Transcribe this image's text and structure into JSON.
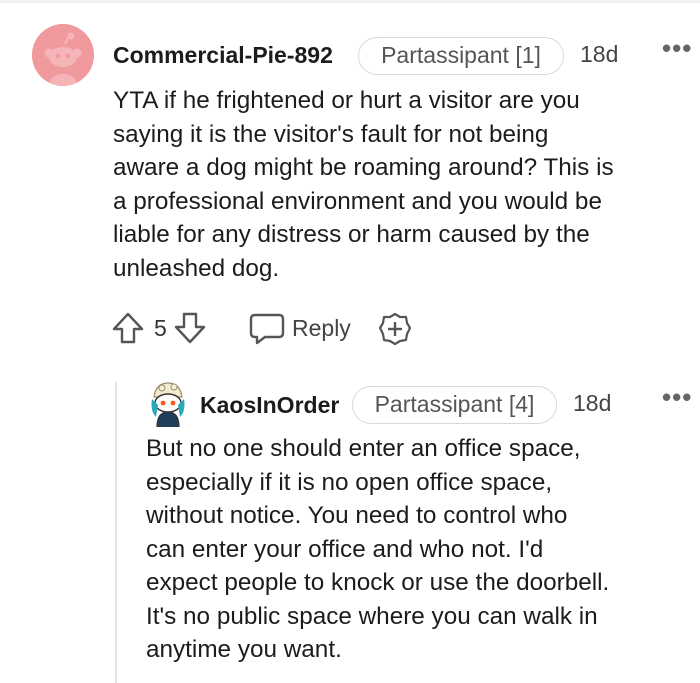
{
  "comment_parent": {
    "username": "Commercial-Pie-892",
    "flair": "Partassipant [1]",
    "timestamp": "18d",
    "more_icon": "more-horizontal-icon",
    "body": "YTA if he frightened or hurt a visitor are you\nsaying it is the visitor's fault for not being\naware a dog might be roaming around? This is\na professional environment and you would be\nliable for any distress or harm caused by the\nunleashed dog.",
    "vote_count": "5",
    "reply_label": "Reply",
    "avatar_color": "#f09a9e"
  },
  "comment_reply": {
    "username": "KaosInOrder",
    "flair": "Partassipant [4]",
    "timestamp": "18d",
    "more_icon": "more-horizontal-icon",
    "body": "But no one should enter an office space,\nespecially if it is no open office space,\nwithout notice. You need to control who\ncan enter your office and who not. I'd\nexpect people to knock or use the doorbell.\nIt's no public space where you can walk in\nanytime you want."
  },
  "colors": {
    "text": "#1c1c1c",
    "meta": "#444444",
    "flair_border": "#d7d9db",
    "thread_line": "#e3e5e7"
  }
}
